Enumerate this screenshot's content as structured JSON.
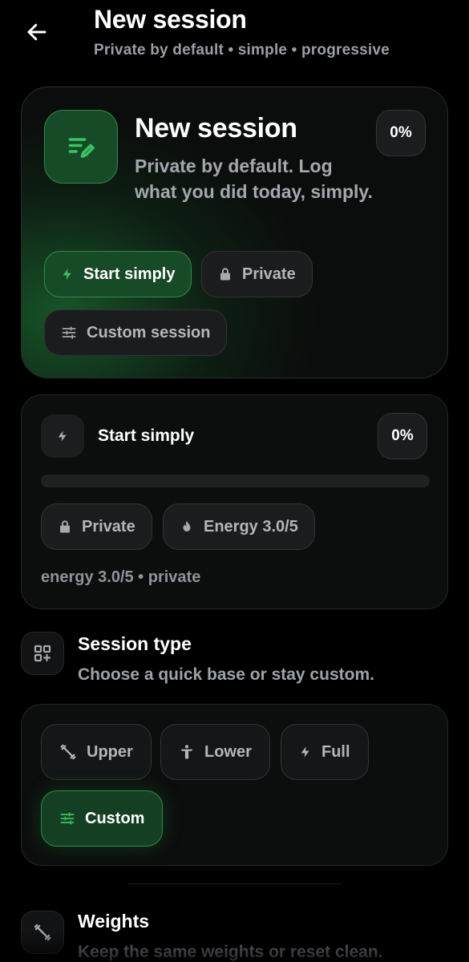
{
  "header": {
    "title": "New session",
    "subtitle": "Private by default • simple • progressive",
    "back_icon": "arrow-left-icon"
  },
  "hero": {
    "title": "New session",
    "description": "Private by default. Log what you did today, simply.",
    "progress_label": "0%",
    "icon": "edit-list-icon",
    "chips": [
      {
        "label": "Start simply",
        "icon": "bolt-icon",
        "active": true
      },
      {
        "label": "Private",
        "icon": "lock-icon",
        "active": false
      },
      {
        "label": "Custom session",
        "icon": "sliders-icon",
        "active": false
      }
    ]
  },
  "status": {
    "title": "Start simply",
    "progress_label": "0%",
    "progress_fraction": 0,
    "chips": [
      {
        "label": "Private",
        "icon": "lock-icon"
      },
      {
        "label": "Energy 3.0/5",
        "icon": "flame-icon"
      }
    ],
    "footer": "energy 3.0/5 • private"
  },
  "session_type": {
    "title": "Session type",
    "subtitle": "Choose a quick base or stay custom.",
    "icon": "grid-plus-icon",
    "options": [
      {
        "label": "Upper",
        "icon": "dumbbell-icon",
        "active": false
      },
      {
        "label": "Lower",
        "icon": "person-icon",
        "active": false
      },
      {
        "label": "Full",
        "icon": "bolt-icon",
        "active": false
      },
      {
        "label": "Custom",
        "icon": "sliders-icon",
        "active": true
      }
    ]
  },
  "weights": {
    "title": "Weights",
    "subtitle": "Keep the same weights or reset clean.",
    "icon": "dumbbell-icon"
  },
  "colors": {
    "accent": "#2f9a4c",
    "accent_dark": "#174a27",
    "background": "#000000",
    "card": "#0c0d0d",
    "muted_text": "#9ea2a9"
  }
}
